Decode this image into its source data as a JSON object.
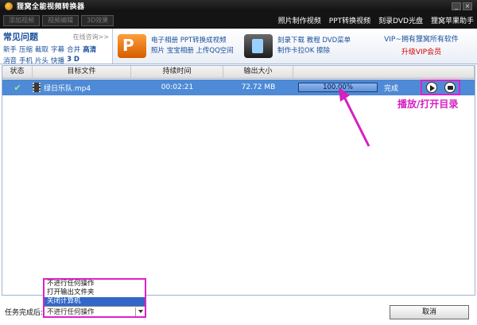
{
  "app": {
    "title": "狸窝全能视频转换器"
  },
  "toolbar": {
    "buttons": [
      "添加视频",
      "视频编辑",
      "3D效果"
    ],
    "links": [
      "照片制作视频",
      "PPT转换视频",
      "刻录DVD光盘",
      "狸窝苹果助手"
    ]
  },
  "banner": {
    "faq": {
      "title": "常见问题",
      "more": "在线咨询>>",
      "row1": [
        "新手",
        "压缩",
        "截取",
        "字幕",
        "合并",
        "高清"
      ],
      "row2": [
        "消音",
        "手机",
        "片头",
        "快播",
        "3 D"
      ]
    },
    "promo1": {
      "line1": "电子相册  PPT转换成视频",
      "line2": "照片  宝宝相册  上传QQ空间"
    },
    "promo2": {
      "line1": "刻录下载  教程  DVD菜单",
      "line2": "制作卡拉OK  擦除"
    },
    "vip": {
      "line1": "VIP~拥有狸窝所有软件",
      "line2": "升级VIP会员"
    }
  },
  "table": {
    "headers": {
      "status": "状态",
      "file": "目标文件",
      "duration": "持续时间",
      "size": "输出大小"
    },
    "row": {
      "file": "绿日乐队.mp4",
      "duration": "00:02:21",
      "size": "72.72 MB",
      "progress_label": "100.00%",
      "progress": 1.0,
      "status_text": "完成"
    }
  },
  "annotation": {
    "text": "播放/打开目录",
    "color": "#d61fc0"
  },
  "completion": {
    "label": "任务完成后:",
    "options": [
      "不进行任何操作",
      "打开输出文件夹",
      "关闭计算机"
    ],
    "selected_index": 2,
    "current_value": "不进行任何操作"
  },
  "buttons": {
    "cancel": "取消"
  }
}
